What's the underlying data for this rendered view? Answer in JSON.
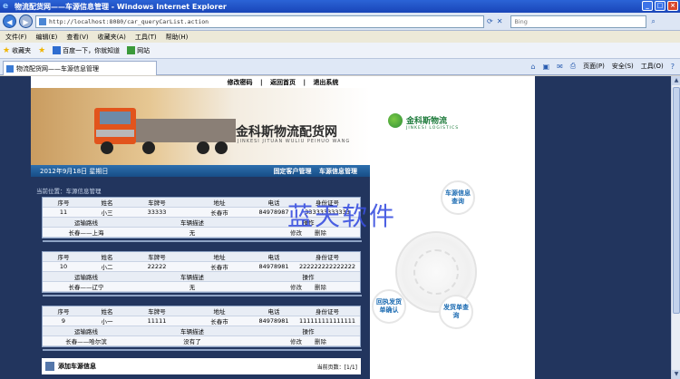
{
  "window": {
    "title": "物流配货网——车源信息管理 - Windows Internet Explorer",
    "buttons": [
      "_",
      "□",
      "×"
    ]
  },
  "addressbar": {
    "url": "http://localhost:8080/car_queryCarList.action",
    "search_placeholder": "Bing"
  },
  "menu": [
    "文件(F)",
    "编辑(E)",
    "查看(V)",
    "收藏夹(A)",
    "工具(T)",
    "帮助(H)"
  ],
  "favorites": {
    "label": "收藏夹",
    "items": [
      "百度一下，你就知道",
      "网站"
    ]
  },
  "tab": {
    "label": "物流配货网——车源信息管理"
  },
  "commandbar": {
    "page": "页面(P)",
    "safety": "安全(S)",
    "tools": "工具(O)"
  },
  "site": {
    "toplinks": [
      "修改密码",
      "返回首页",
      "退出系统"
    ],
    "separator": "|",
    "brand_cn": "金科斯物流配货网",
    "brand_en": "JINKESI JITUAN WULIU PEIHUO WANG",
    "logo_cn": "金科斯物流",
    "logo_en": "JINKESI LOGISTICS",
    "date": "2012年9月18日 星期日",
    "nav": [
      "固定客户管理",
      "车源信息管理"
    ],
    "breadcrumb": "当前位置：车源信息管理",
    "headers": {
      "id": "序号",
      "name": "姓名",
      "plate": "车牌号",
      "address": "地址",
      "phone": "电话",
      "idcard": "身份证号",
      "route": "运输路线",
      "desc": "车辆描述",
      "ops": "操作"
    },
    "records": [
      {
        "id": "11",
        "name": "小三",
        "plate": "33333",
        "address": "长春市",
        "phone": "84978987",
        "idcard": "333333333333",
        "route": "长春——上海",
        "desc": "无",
        "edit": "修改",
        "del": "删除"
      },
      {
        "id": "10",
        "name": "小二",
        "plate": "22222",
        "address": "长春市",
        "phone": "84978981",
        "idcard": "222222222222222",
        "route": "长春——辽宁",
        "desc": "无",
        "edit": "修改",
        "del": "删除"
      },
      {
        "id": "9",
        "name": "小一",
        "plate": "11111",
        "address": "长春市",
        "phone": "84978981",
        "idcard": "111111111111111",
        "route": "长春——哈尔滨",
        "desc": "没有了",
        "edit": "修改",
        "del": "删除"
      }
    ],
    "add_label": "添加车源信息",
    "page_info": "当前页数：[1/1]",
    "side_buttons": [
      "车源信息查询",
      "回执发货单确认",
      "发货单查询"
    ],
    "watermark": "蓝天软件"
  }
}
